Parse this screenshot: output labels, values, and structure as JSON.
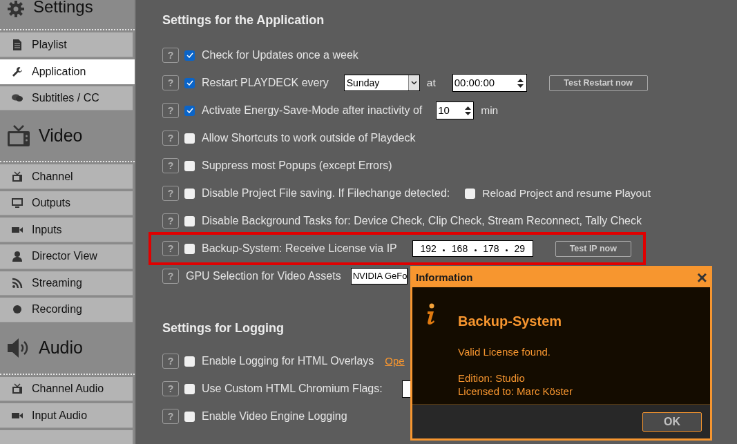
{
  "sidebar": {
    "sections": [
      {
        "title": "Settings",
        "items": [
          {
            "label": "Playlist",
            "selected": false
          },
          {
            "label": "Application",
            "selected": true
          },
          {
            "label": "Subtitles / CC",
            "selected": false
          }
        ]
      },
      {
        "title": "Video",
        "items": [
          {
            "label": "Channel",
            "selected": false
          },
          {
            "label": "Outputs",
            "selected": false
          },
          {
            "label": "Inputs",
            "selected": false
          },
          {
            "label": "Director View",
            "selected": false
          },
          {
            "label": "Streaming",
            "selected": false
          },
          {
            "label": "Recording",
            "selected": false
          }
        ]
      },
      {
        "title": "Audio",
        "items": [
          {
            "label": "Channel Audio",
            "selected": false
          },
          {
            "label": "Input Audio",
            "selected": false
          }
        ]
      }
    ]
  },
  "groups": [
    {
      "title": "Settings for the Application",
      "rows": [
        {
          "help": "?",
          "checked": true,
          "label": "Check for Updates once a week",
          "highlighted": false,
          "controls": []
        },
        {
          "help": "?",
          "checked": true,
          "label": "Restart PLAYDECK every",
          "highlighted": false,
          "controls": [
            {
              "kind": "select",
              "value": "Sunday"
            },
            {
              "kind": "text",
              "text": "at"
            },
            {
              "kind": "time",
              "value": "00:00:00"
            },
            {
              "kind": "button",
              "text": "Test Restart now"
            }
          ]
        },
        {
          "help": "?",
          "checked": true,
          "label": "Activate Energy-Save-Mode after inactivity of",
          "highlighted": false,
          "controls": [
            {
              "kind": "spin",
              "value": "10"
            },
            {
              "kind": "text",
              "text": "min"
            }
          ]
        },
        {
          "help": "?",
          "checked": false,
          "label": "Allow Shortcuts to work outside of Playdeck",
          "highlighted": false,
          "controls": []
        },
        {
          "help": "?",
          "checked": false,
          "label": "Suppress most Popups (except Errors)",
          "highlighted": false,
          "controls": []
        },
        {
          "help": "?",
          "checked": false,
          "label": "Disable Project File saving. If Filechange detected:",
          "highlighted": false,
          "controls": [
            {
              "kind": "checkbox",
              "checked": false,
              "text": "Reload Project and resume Playout"
            }
          ]
        },
        {
          "help": "?",
          "checked": false,
          "label": "Disable Background Tasks for: Device Check, Clip Check, Stream Reconnect, Tally Check",
          "highlighted": false,
          "controls": []
        },
        {
          "help": "?",
          "checked": false,
          "label": "Backup-System: Receive License via IP",
          "highlighted": true,
          "controls": [
            {
              "kind": "ip",
              "octets": [
                "192",
                "168",
                "178",
                "29"
              ]
            },
            {
              "kind": "button",
              "text": "Test IP now"
            }
          ]
        },
        {
          "help": "?",
          "label": "GPU Selection for Video Assets",
          "highlighted": false,
          "controls": [
            {
              "kind": "select",
              "value": "NVIDIA GeFo"
            }
          ]
        }
      ]
    },
    {
      "title": "Settings for Logging",
      "rows": [
        {
          "help": "?",
          "checked": false,
          "label": "Enable Logging for HTML Overlays",
          "highlighted": false,
          "controls": [
            {
              "kind": "link",
              "text": "Ope"
            }
          ]
        },
        {
          "help": "?",
          "checked": false,
          "label": "Use Custom HTML Chromium Flags:",
          "highlighted": false,
          "controls": [
            {
              "kind": "field"
            }
          ]
        },
        {
          "help": "?",
          "checked": false,
          "label": "Enable Video Engine Logging",
          "highlighted": false,
          "controls": []
        }
      ]
    }
  ],
  "dialog": {
    "title": "Information",
    "close": "×",
    "heading": "Backup-System",
    "lines": [
      "Valid License found.",
      "Edition: Studio",
      "Licensed to: Marc Köster"
    ],
    "button": "OK"
  }
}
